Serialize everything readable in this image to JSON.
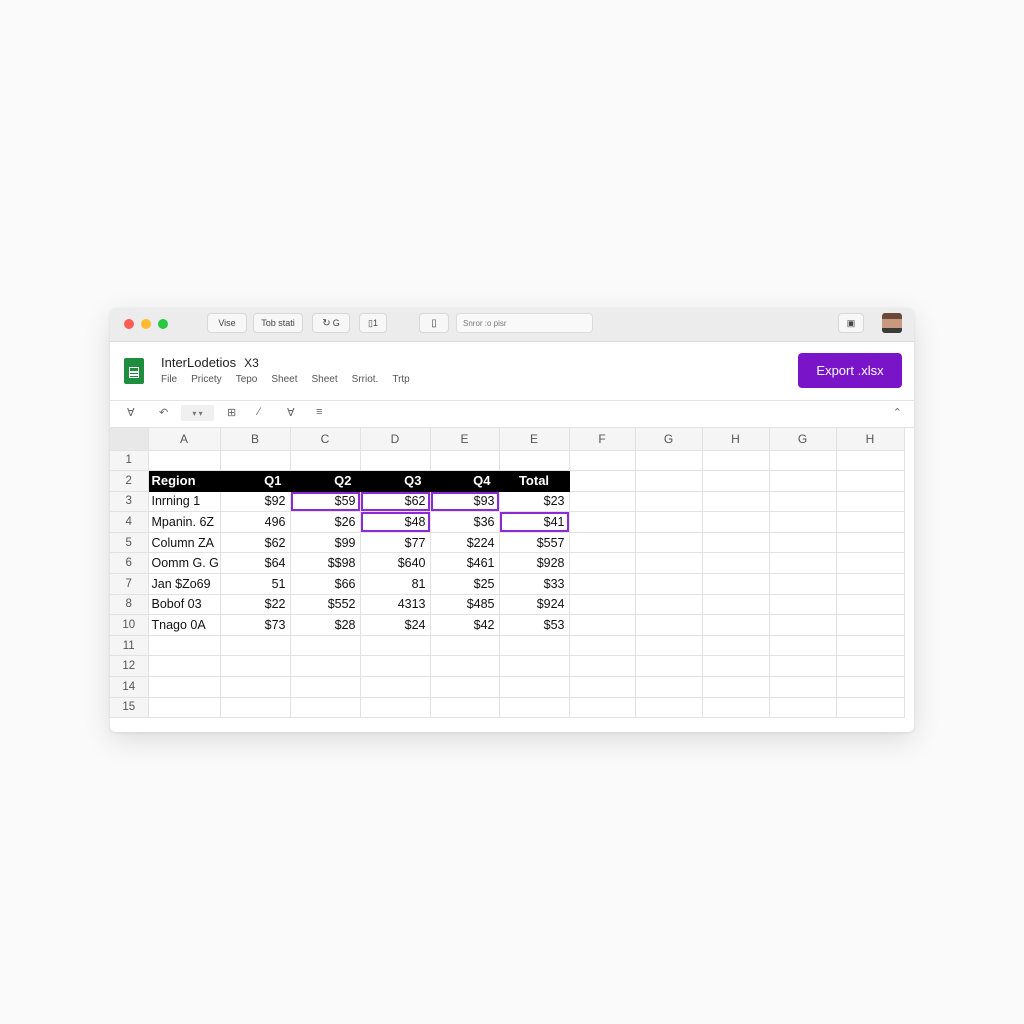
{
  "titlebar": {
    "chips": [
      "Vise",
      "Tob stati",
      "G",
      "1"
    ],
    "search_placeholder": "Snror :o pisr"
  },
  "header": {
    "doc_title": "InterLodetios",
    "doc_ext": "X3",
    "menu": [
      "File",
      "Pricety",
      "Tepo",
      "Sheet",
      "Sheet",
      "Srriot.",
      "Trtp"
    ],
    "export_label": "Export .xlsx"
  },
  "toolbar": {
    "icons": [
      "text-format-icon",
      "undo-icon",
      "dropdown-icon",
      "grid-icon",
      "pen-icon",
      "font-icon",
      "menu-icon",
      "collapse-icon"
    ]
  },
  "grid": {
    "columns": [
      "A",
      "B",
      "C",
      "D",
      "E",
      "E",
      "F",
      "G",
      "H",
      "G",
      "H"
    ],
    "row_numbers": [
      "1",
      "2",
      "3",
      "4",
      "5",
      "6",
      "7",
      "8",
      "10",
      "11",
      "12",
      "14",
      "15"
    ],
    "header_row": [
      "Region",
      "Q1",
      "Q2",
      "Q3",
      "Q4",
      "Total"
    ],
    "rows": [
      [
        "Inrning 1",
        "$92",
        "$59",
        "$62",
        "$93",
        "$23"
      ],
      [
        "Mpanin. 6Z",
        "496",
        "$26",
        "$48",
        "$36",
        "$41"
      ],
      [
        "Column ZA",
        "$62",
        "$99",
        "$77",
        "$224",
        "$557"
      ],
      [
        "Oomm G. G",
        "$64",
        "$$98",
        "$640",
        "$461",
        "$928"
      ],
      [
        "Jan $Zo69",
        "51",
        "$66",
        "81",
        "$25",
        "$33"
      ],
      [
        "Bobof 03",
        "$22",
        "$552",
        "4313",
        "$485",
        "$924"
      ],
      [
        "Tnago 0A",
        "$73",
        "$28",
        "$24",
        "$42",
        "$53"
      ]
    ]
  },
  "colors": {
    "accent": "#7a14c9",
    "selection": "#8a2bd6",
    "header_fill": "#000000"
  }
}
